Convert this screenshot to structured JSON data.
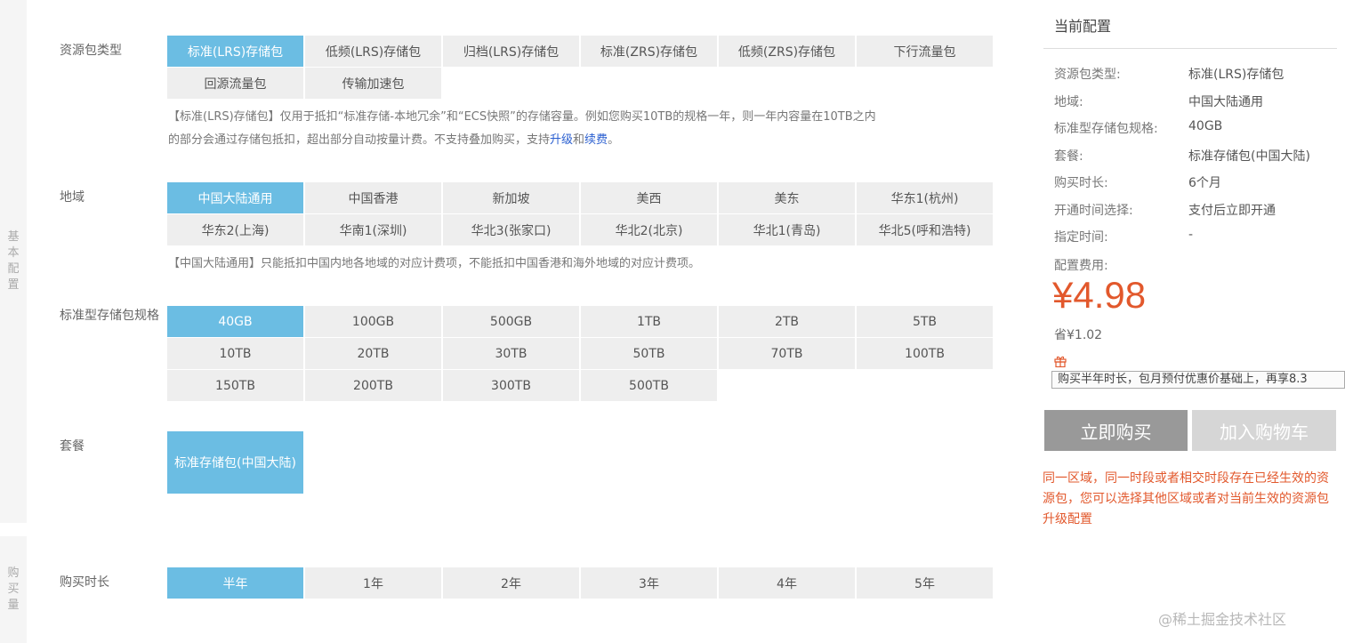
{
  "side_tabs": {
    "basic": "基本配置",
    "purchase": "购买量"
  },
  "package_type": {
    "label": "资源包类型",
    "options": [
      "标准(LRS)存储包",
      "低频(LRS)存储包",
      "归档(LRS)存储包",
      "标准(ZRS)存储包",
      "低频(ZRS)存储包",
      "下行流量包",
      "回源流量包",
      "传输加速包"
    ],
    "selected": 0,
    "desc_part1": "【标准(LRS)存储包】仅用于抵扣“标准存储-本地冗余”和“ECS快照”的存储容量。例如您购买10TB的规格一年，则一年内容量在10TB之内",
    "desc_part2": "的部分会通过存储包抵扣，超出部分自动按量计费。不支持叠加购买，支持",
    "desc_link_upgrade": "升级",
    "desc_and": "和",
    "desc_link_renew": "续费",
    "desc_end": "。"
  },
  "region": {
    "label": "地域",
    "options": [
      "中国大陆通用",
      "中国香港",
      "新加坡",
      "美西",
      "美东",
      "华东1(杭州)",
      "华东2(上海)",
      "华南1(深圳)",
      "华北3(张家口)",
      "华北2(北京)",
      "华北1(青岛)",
      "华北5(呼和浩特)"
    ],
    "selected": 0,
    "desc": "【中国大陆通用】只能抵扣中国内地各地域的对应计费项，不能抵扣中国香港和海外地域的对应计费项。"
  },
  "spec": {
    "label": "标准型存储包规格",
    "options": [
      "40GB",
      "100GB",
      "500GB",
      "1TB",
      "2TB",
      "5TB",
      "10TB",
      "20TB",
      "30TB",
      "50TB",
      "70TB",
      "100TB",
      "150TB",
      "200TB",
      "300TB",
      "500TB"
    ],
    "selected": 0
  },
  "plan": {
    "label": "套餐",
    "option": "标准存储包(中国大陆)"
  },
  "duration": {
    "label": "购买时长",
    "options": [
      "半年",
      "1年",
      "2年",
      "3年",
      "4年",
      "5年"
    ],
    "selected": 0
  },
  "summary": {
    "title": "当前配置",
    "rows": [
      {
        "k": "资源包类型:",
        "v": "标准(LRS)存储包"
      },
      {
        "k": "地域:",
        "v": "中国大陆通用"
      },
      {
        "k": "标准型存储包规格:",
        "v": "40GB"
      },
      {
        "k": "套餐:",
        "v": "标准存储包(中国大陆)"
      },
      {
        "k": "购买时长:",
        "v": "6个月"
      },
      {
        "k": "开通时间选择:",
        "v": "支付后立即开通"
      },
      {
        "k": "指定时间:",
        "v": "-"
      }
    ],
    "fee_label": "配置费用:",
    "price": "¥4.98",
    "save": "省¥1.02",
    "tip": "购买半年时长，包月预付优惠价基础上，再享8.3",
    "buy_label": "立即购买",
    "cart_label": "加入购物车",
    "warning": "同一区域，同一时段或者相交时段存在已经生效的资源包，您可以选择其他区域或者对当前生效的资源包升级配置"
  },
  "watermark": "@稀土掘金技术社区",
  "colors": {
    "selected": "#6bbde3",
    "option": "#eeeeee",
    "price": "#e2582c",
    "link": "#2a5fd0"
  }
}
